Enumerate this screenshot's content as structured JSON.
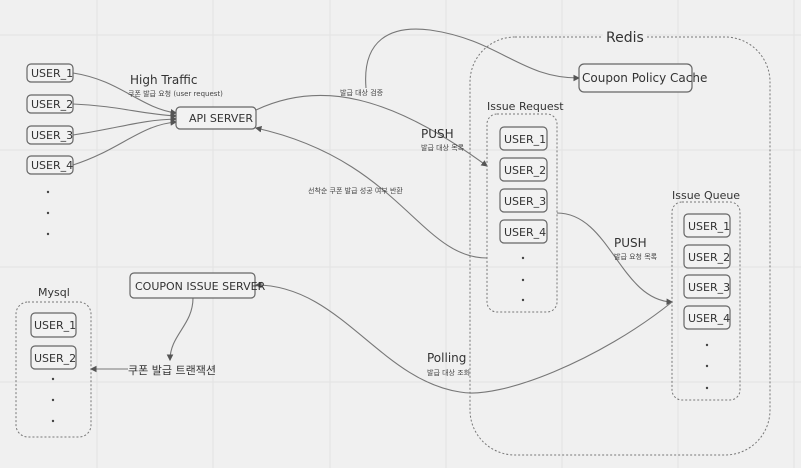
{
  "clients": {
    "users": [
      "USER_1",
      "USER_2",
      "USER_3",
      "USER_4"
    ],
    "ellipsis": "."
  },
  "labels": {
    "high_traffic": "High Traffic",
    "high_traffic_sub": "쿠폰 발급 요청 (user request)",
    "verify": "발급 대상 검증",
    "push1": "PUSH",
    "push1_sub": "발급 대상 목록",
    "return": "선착순 쿠폰 발급 성공 여부 반환",
    "push2": "PUSH",
    "push2_sub": "발급 요청 목록",
    "polling": "Polling",
    "polling_sub": "발급 대상 조회",
    "transaction": "쿠폰 발급 트랜잭션"
  },
  "api_server": "API SERVER",
  "coupon_issue_server": "COUPON ISSUE  SERVER",
  "redis": {
    "title": "Redis",
    "policy_cache": "Coupon Policy Cache",
    "issue_request": {
      "title": "Issue Request",
      "users": [
        "USER_1",
        "USER_2",
        "USER_3",
        "USER_4"
      ]
    },
    "issue_queue": {
      "title": "Issue Queue",
      "users": [
        "USER_1",
        "USER_2",
        "USER_3",
        "USER_4"
      ]
    }
  },
  "mysql": {
    "title": "Mysql",
    "users": [
      "USER_1",
      "USER_2"
    ]
  }
}
